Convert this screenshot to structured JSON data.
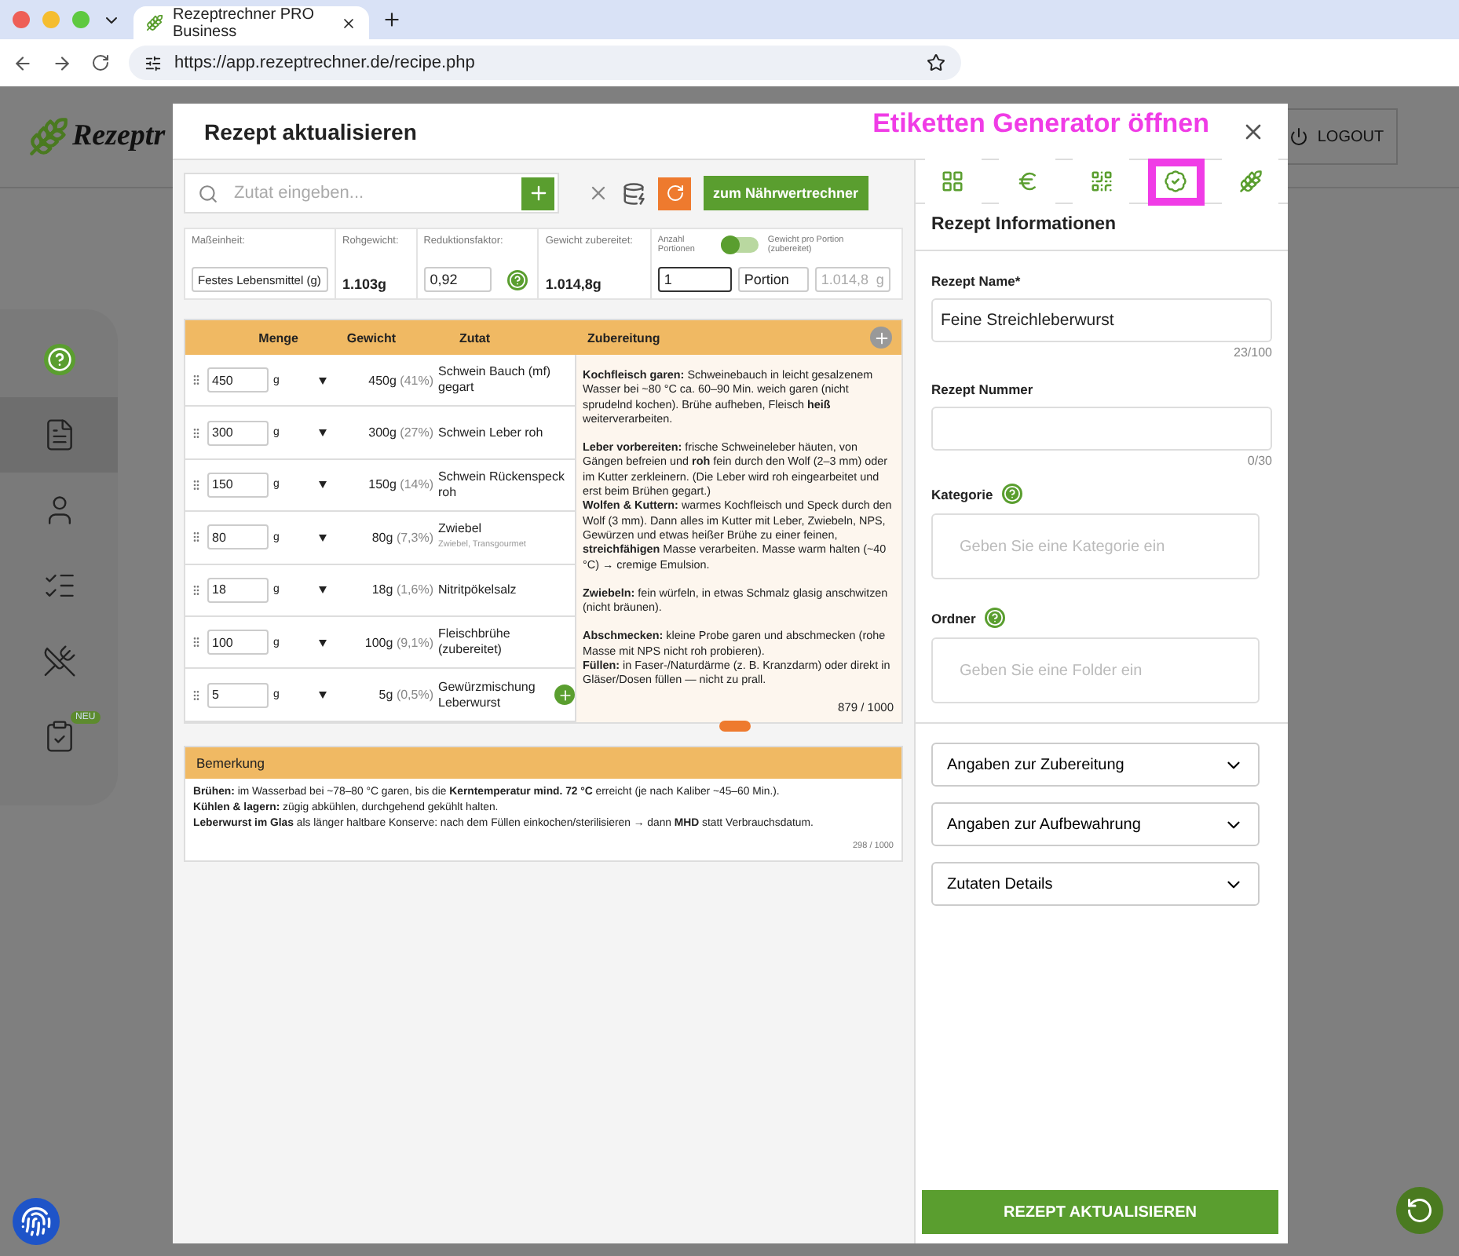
{
  "browser": {
    "tab_title": "Rezeptrechner PRO Business",
    "url": "https://app.rezeptrechner.de/recipe.php"
  },
  "app": {
    "logo_text": "Rezeptr",
    "logout": "LOGOUT",
    "sidebar": [
      {
        "selected": false
      },
      {
        "selected": true
      },
      {
        "selected": false
      },
      {
        "selected": false
      },
      {
        "selected": false
      },
      {
        "selected": false,
        "badge": "NEU"
      }
    ]
  },
  "modal": {
    "title": "Rezept aktualisieren",
    "annotation": "Etiketten Generator öffnen",
    "search": {
      "placeholder": "Zutat eingeben..."
    },
    "calc_button": "zum Nährwertrechner",
    "params": {
      "unit_label": "Maßeinheit:",
      "unit_value": "Festes Lebensmittel (g)",
      "raw_label": "Rohgewicht:",
      "raw_value": "1.103g",
      "reduction_label": "Reduktionsfaktor:",
      "reduction_value": "0,92",
      "cooked_label": "Gewicht zubereitet:",
      "cooked_value": "1.014,8g",
      "portions_label": "Anzahl Portionen",
      "portion_weight_label": "Gewicht pro Portion (zubereitet)",
      "toggle_on": false,
      "portions_value": "1",
      "portion_unit": "Portion",
      "portion_weight": "1.014,8",
      "portion_weight_unit": "g"
    },
    "table": {
      "columns": [
        "Menge",
        "Gewicht",
        "Zutat",
        "Zubereitung"
      ],
      "rows": [
        {
          "amount": "450",
          "unit": "g",
          "weight": "450g",
          "percent": "(41%)",
          "name": "Schwein Bauch (mf) gegart"
        },
        {
          "amount": "300",
          "unit": "g",
          "weight": "300g",
          "percent": "(27%)",
          "name": "Schwein Leber roh"
        },
        {
          "amount": "150",
          "unit": "g",
          "weight": "150g",
          "percent": "(14%)",
          "name": "Schwein Rückenspeck roh"
        },
        {
          "amount": "80",
          "unit": "g",
          "weight": "80g",
          "percent": "(7,3%)",
          "name": "Zwiebel",
          "sub": "Zwiebel, Transgourmet"
        },
        {
          "amount": "18",
          "unit": "g",
          "weight": "18g",
          "percent": "(1,6%)",
          "name": "Nitritpökelsalz"
        },
        {
          "amount": "100",
          "unit": "g",
          "weight": "100g",
          "percent": "(9,1%)",
          "name": "Fleischbrühe (zubereitet)"
        },
        {
          "amount": "5",
          "unit": "g",
          "weight": "5g",
          "percent": "(0,5%)",
          "name": "Gewürzmischung Leberwurst"
        }
      ],
      "preparation": [
        [
          "**Kochfleisch garen:** Schweinebauch in leicht gesalzenem Wasser bei ~80 °C ca. 60–90 Min. weich garen (nicht sprudelnd kochen). Brühe aufheben, Fleisch **heiß** weiterverarbeiten."
        ],
        [
          "**Leber vorbereiten:** frische Schweineleber häuten, von Gängen befreien und **roh** fein durch den Wolf (2–3 mm) oder im Kutter zerkleinern. (Die Leber wird roh eingearbeitet und erst beim Brühen gegart.)",
          "**Wolfen & Kuttern:** warmes Kochfleisch und Speck durch den Wolf (3 mm). Dann alles im Kutter mit Leber, Zwiebeln, NPS, Gewürzen und etwas heißer Brühe zu einer feinen, **streichfähigen** Masse verarbeiten. Masse warm halten (~40 °C) → cremige Emulsion."
        ],
        [
          "**Zwiebeln:** fein würfeln, in etwas Schmalz glasig anschwitzen (nicht bräunen)."
        ],
        [
          "**Abschmecken:** kleine Probe garen und abschmecken (rohe Masse mit NPS nicht roh probieren).",
          "**Füllen:** in Faser-/Naturdärme (z. B. Kranzdarm) oder direkt in Gläser/Dosen füllen — nicht zu prall."
        ]
      ],
      "preparation_count": "879 / 1000"
    },
    "remark": {
      "title": "Bemerkung",
      "lines": [
        "**Brühen:** im Wasserbad bei ~78–80 °C garen, bis die **Kerntemperatur mind. 72 °C** erreicht (je nach Kaliber ~45–60 Min.).",
        "**Kühlen & lagern:** zügig abkühlen, durchgehend gekühlt halten.",
        "**Leberwurst im Glas** als länger haltbare Konserve: nach dem Füllen einkochen/sterilisieren → dann **MHD** statt Verbrauchsdatum."
      ],
      "count": "298 / 1000"
    },
    "side_tabs": [
      {
        "annotated": false
      },
      {
        "annotated": false
      },
      {
        "annotated": false
      },
      {
        "annotated": true
      },
      {
        "annotated": false
      }
    ],
    "info": {
      "title": "Rezept Informationen",
      "name_label": "Rezept Name*",
      "name_value": "Feine Streichleberwurst",
      "name_count": "23/100",
      "number_label": "Rezept Nummer",
      "number_count": "0/30",
      "category_label": "Kategorie",
      "category_placeholder": "Geben Sie eine Kategorie ein",
      "folder_label": "Ordner",
      "folder_placeholder": "Geben Sie eine Folder ein"
    },
    "sections": [
      {
        "label": "Angaben zur Zubereitung",
        "expanded": false
      },
      {
        "label": "Angaben zur Aufbewahrung",
        "expanded": false
      },
      {
        "label": "Zutaten Details",
        "expanded": false
      }
    ],
    "submit": "REZEPT AKTUALISIEREN"
  }
}
